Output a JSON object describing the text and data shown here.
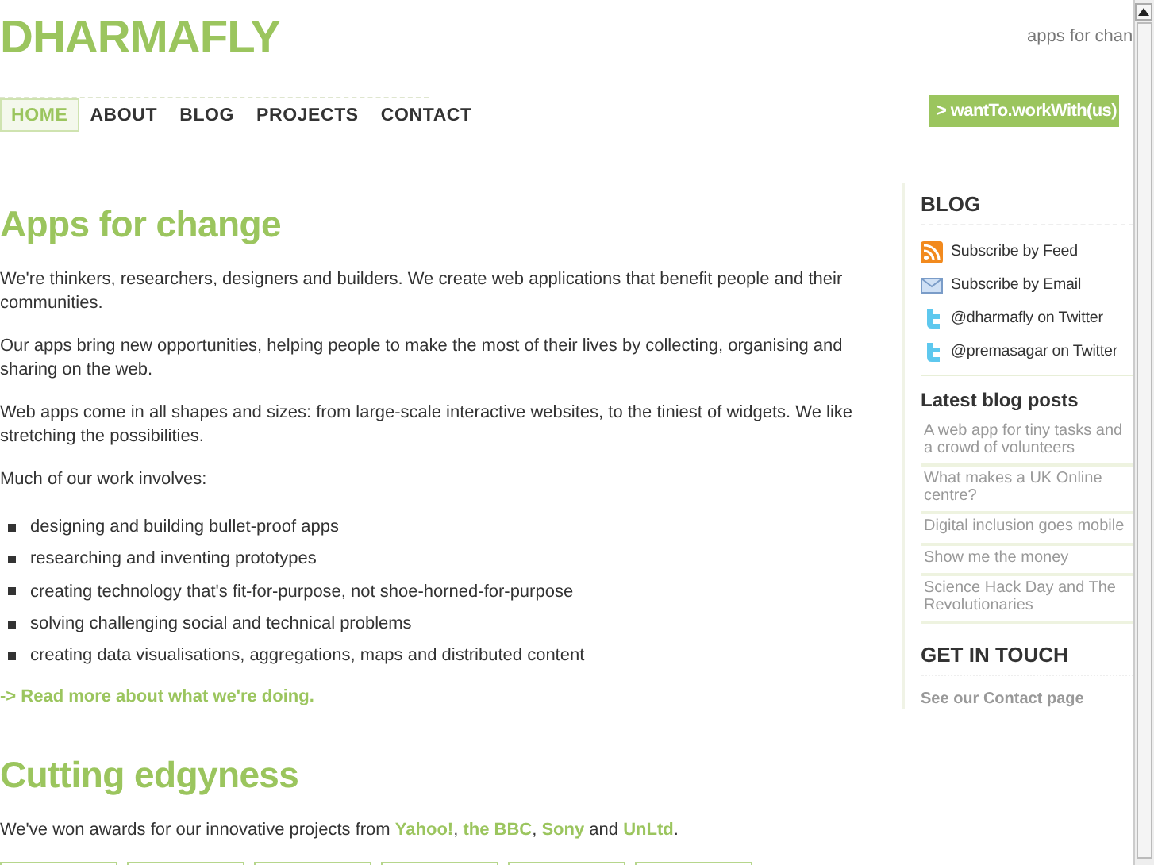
{
  "site": {
    "logo": "DHARMAFLY",
    "tagline": "apps for chan",
    "cta": "> wantTo.workWith(us)"
  },
  "nav": [
    {
      "label": "HOME",
      "selected": true
    },
    {
      "label": "ABOUT",
      "selected": false
    },
    {
      "label": "BLOG",
      "selected": false
    },
    {
      "label": "PROJECTS",
      "selected": false
    },
    {
      "label": "CONTACT",
      "selected": false
    }
  ],
  "main": {
    "heading": "Apps for change",
    "paragraphs": [
      "We're thinkers, researchers, designers and builders. We create web applications that benefit people and their communities.",
      "Our apps bring new opportunities, helping people to make the most of their lives by collecting, organising and sharing on the web.",
      "Web apps come in all shapes and sizes: from large-scale interactive websites, to the tiniest of widgets. We like stretching the possibilities.",
      "Much of our work involves:"
    ],
    "bullets": [
      "designing and building bullet-proof apps",
      "researching and inventing prototypes",
      "creating technology that's fit-for-purpose, not shoe-horned-for-purpose",
      "solving challenging social and technical problems",
      "creating data visualisations, aggregations, maps and distributed content"
    ],
    "more_link": "-> Read more about what we're doing.",
    "heading_2": "Cutting edgyness",
    "awards": [
      {
        "kind": "text",
        "text": "We've won awards for our innovative projects from "
      },
      {
        "kind": "link",
        "text": "Yahoo!"
      },
      {
        "kind": "text",
        "text": ", "
      },
      {
        "kind": "link",
        "text": "the BBC"
      },
      {
        "kind": "text",
        "text": ", "
      },
      {
        "kind": "link",
        "text": "Sony"
      },
      {
        "kind": "text",
        "text": " and "
      },
      {
        "kind": "link",
        "text": "UnLtd"
      },
      {
        "kind": "text",
        "text": "."
      }
    ],
    "thumbnails": [
      {
        "kind": "picture"
      },
      {
        "kind": "picture"
      },
      {
        "kind": "picture"
      },
      {
        "kind": "picture"
      },
      {
        "kind": "picture"
      },
      {
        "kind": "picture"
      }
    ]
  },
  "sidebar": {
    "blog_title": "BLOG",
    "subscribe": [
      {
        "kind": "feed",
        "label": "Subscribe by Feed"
      },
      {
        "kind": "email",
        "label": "Subscribe by Email"
      },
      {
        "kind": "bird",
        "label": "@dharmafly on Twitter"
      },
      {
        "kind": "bird",
        "label": "@premasagar on Twitter"
      }
    ],
    "posts_title": "Latest blog posts",
    "posts": [
      "A web app for tiny tasks and a crowd of volunteers",
      "What makes a UK Online centre?",
      "Digital inclusion goes mobile",
      "Show me the money",
      "Science Hack Day and The Revolutionaries"
    ],
    "contact_title": "GET IN TOUCH",
    "contact_link": "See our Contact page"
  }
}
